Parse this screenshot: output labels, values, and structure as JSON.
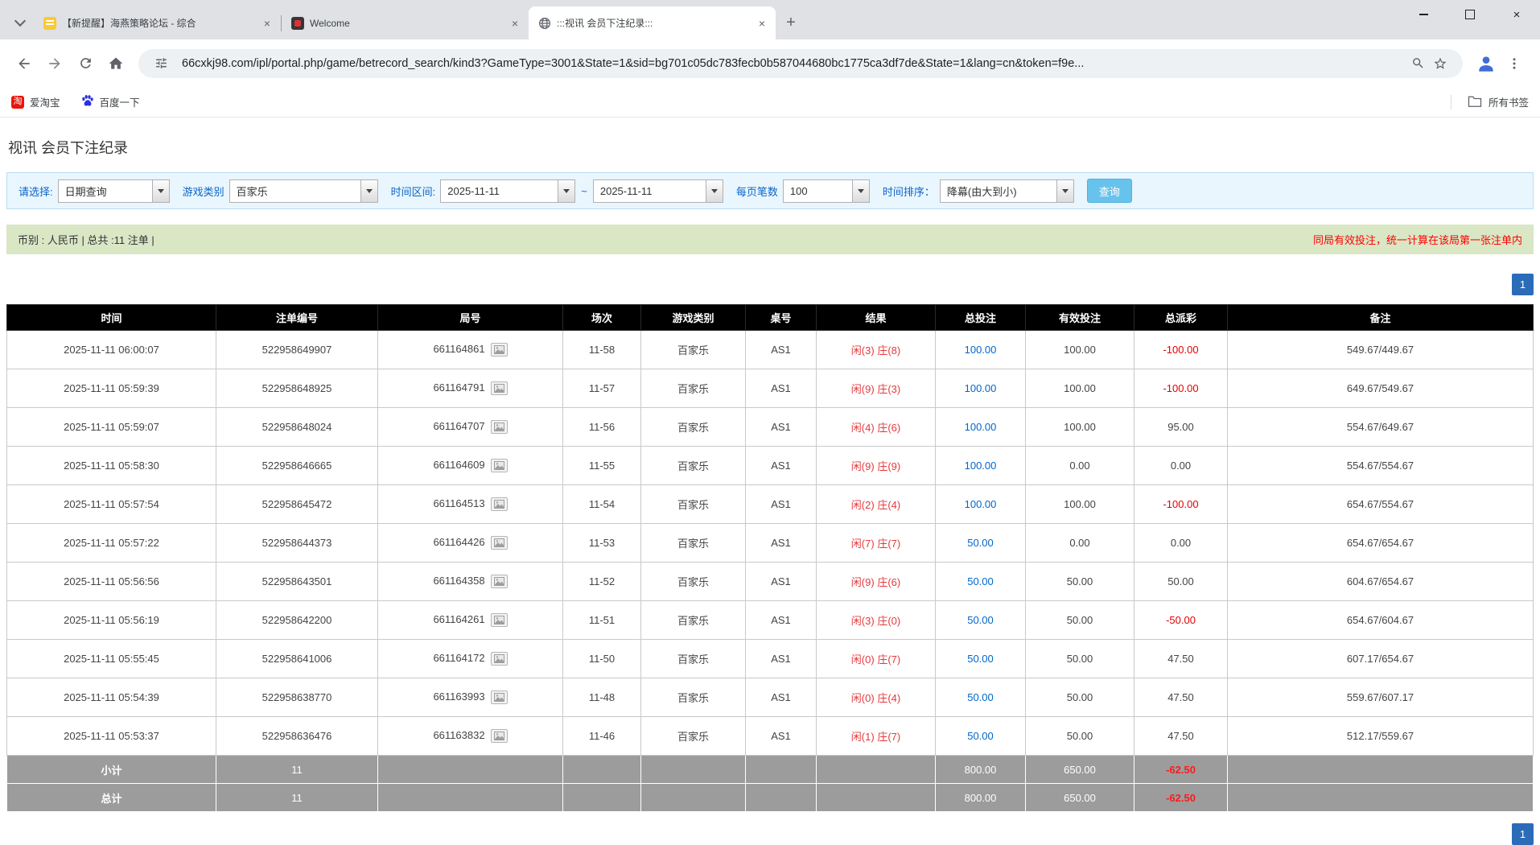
{
  "browser": {
    "tabs": [
      {
        "title": "【新提醒】海燕策略论坛 - 综合",
        "active": false
      },
      {
        "title": "Welcome",
        "active": false
      },
      {
        "title": ":::视讯 会员下注纪录:::",
        "active": true
      }
    ],
    "url": "66cxkj98.com/ipl/portal.php/game/betrecord_search/kind3?GameType=3001&State=1&sid=bg701c05dc783fecb0b587044680bc1775ca3df7de&State=1&lang=cn&token=f9e...",
    "bookmarks": [
      {
        "label": "爱淘宝"
      },
      {
        "label": "百度一下"
      }
    ],
    "all_bookmarks_label": "所有书签",
    "icons": {
      "tab_close": "×",
      "new_tab": "+",
      "close_window": "×",
      "taobao_glyph": "淘"
    }
  },
  "page": {
    "title": "视讯 会员下注纪录",
    "filters": {
      "select_label": "请选择:",
      "select_value": "日期查询",
      "game_type_label": "游戏类别",
      "game_type_value": "百家乐",
      "date_range_label": "时间区间:",
      "date_from": "2025-11-11",
      "date_to": "2025-11-11",
      "tilde": "~",
      "page_size_label": "每页笔数",
      "page_size_value": "100",
      "sort_label": "时间排序：",
      "sort_value": "降幕(由大到小)",
      "search_button": "查询"
    },
    "info": {
      "left": "币别 : 人民币 | 总共 :11 注单 |",
      "right": "同局有效投注，统一计算在该局第一张注单内"
    },
    "pagination": {
      "current": "1"
    },
    "table": {
      "headers": [
        "时间",
        "注单编号",
        "局号",
        "场次",
        "游戏类别",
        "桌号",
        "结果",
        "总投注",
        "有效投注",
        "总派彩",
        "备注"
      ],
      "rows": [
        {
          "time": "2025-11-11 06:00:07",
          "bet_id": "522958649907",
          "round_id": "661164861",
          "session": "11-58",
          "game": "百家乐",
          "table_no": "AS1",
          "result_player": "闲(3)",
          "result_banker": "庄(8)",
          "total_bet": "100.00",
          "valid_bet": "100.00",
          "payout": "-100.00",
          "remark": "549.67/449.67"
        },
        {
          "time": "2025-11-11 05:59:39",
          "bet_id": "522958648925",
          "round_id": "661164791",
          "session": "11-57",
          "game": "百家乐",
          "table_no": "AS1",
          "result_player": "闲(9)",
          "result_banker": "庄(3)",
          "total_bet": "100.00",
          "valid_bet": "100.00",
          "payout": "-100.00",
          "remark": "649.67/549.67"
        },
        {
          "time": "2025-11-11 05:59:07",
          "bet_id": "522958648024",
          "round_id": "661164707",
          "session": "11-56",
          "game": "百家乐",
          "table_no": "AS1",
          "result_player": "闲(4)",
          "result_banker": "庄(6)",
          "total_bet": "100.00",
          "valid_bet": "100.00",
          "payout": "95.00",
          "remark": "554.67/649.67"
        },
        {
          "time": "2025-11-11 05:58:30",
          "bet_id": "522958646665",
          "round_id": "661164609",
          "session": "11-55",
          "game": "百家乐",
          "table_no": "AS1",
          "result_player": "闲(9)",
          "result_banker": "庄(9)",
          "total_bet": "100.00",
          "valid_bet": "0.00",
          "payout": "0.00",
          "remark": "554.67/554.67"
        },
        {
          "time": "2025-11-11 05:57:54",
          "bet_id": "522958645472",
          "round_id": "661164513",
          "session": "11-54",
          "game": "百家乐",
          "table_no": "AS1",
          "result_player": "闲(2)",
          "result_banker": "庄(4)",
          "total_bet": "100.00",
          "valid_bet": "100.00",
          "payout": "-100.00",
          "remark": "654.67/554.67"
        },
        {
          "time": "2025-11-11 05:57:22",
          "bet_id": "522958644373",
          "round_id": "661164426",
          "session": "11-53",
          "game": "百家乐",
          "table_no": "AS1",
          "result_player": "闲(7)",
          "result_banker": "庄(7)",
          "total_bet": "50.00",
          "valid_bet": "0.00",
          "payout": "0.00",
          "remark": "654.67/654.67"
        },
        {
          "time": "2025-11-11 05:56:56",
          "bet_id": "522958643501",
          "round_id": "661164358",
          "session": "11-52",
          "game": "百家乐",
          "table_no": "AS1",
          "result_player": "闲(9)",
          "result_banker": "庄(6)",
          "total_bet": "50.00",
          "valid_bet": "50.00",
          "payout": "50.00",
          "remark": "604.67/654.67"
        },
        {
          "time": "2025-11-11 05:56:19",
          "bet_id": "522958642200",
          "round_id": "661164261",
          "session": "11-51",
          "game": "百家乐",
          "table_no": "AS1",
          "result_player": "闲(3)",
          "result_banker": "庄(0)",
          "total_bet": "50.00",
          "valid_bet": "50.00",
          "payout": "-50.00",
          "remark": "654.67/604.67"
        },
        {
          "time": "2025-11-11 05:55:45",
          "bet_id": "522958641006",
          "round_id": "661164172",
          "session": "11-50",
          "game": "百家乐",
          "table_no": "AS1",
          "result_player": "闲(0)",
          "result_banker": "庄(7)",
          "total_bet": "50.00",
          "valid_bet": "50.00",
          "payout": "47.50",
          "remark": "607.17/654.67"
        },
        {
          "time": "2025-11-11 05:54:39",
          "bet_id": "522958638770",
          "round_id": "661163993",
          "session": "11-48",
          "game": "百家乐",
          "table_no": "AS1",
          "result_player": "闲(0)",
          "result_banker": "庄(4)",
          "total_bet": "50.00",
          "valid_bet": "50.00",
          "payout": "47.50",
          "remark": "559.67/607.17"
        },
        {
          "time": "2025-11-11 05:53:37",
          "bet_id": "522958636476",
          "round_id": "661163832",
          "session": "11-46",
          "game": "百家乐",
          "table_no": "AS1",
          "result_player": "闲(1)",
          "result_banker": "庄(7)",
          "total_bet": "50.00",
          "valid_bet": "50.00",
          "payout": "47.50",
          "remark": "512.17/559.67"
        }
      ],
      "subtotal": {
        "label": "小计",
        "count": "11",
        "total_bet": "800.00",
        "valid_bet": "650.00",
        "payout": "-62.50"
      },
      "total": {
        "label": "总计",
        "count": "11",
        "total_bet": "800.00",
        "valid_bet": "650.00",
        "payout": "-62.50"
      }
    }
  }
}
